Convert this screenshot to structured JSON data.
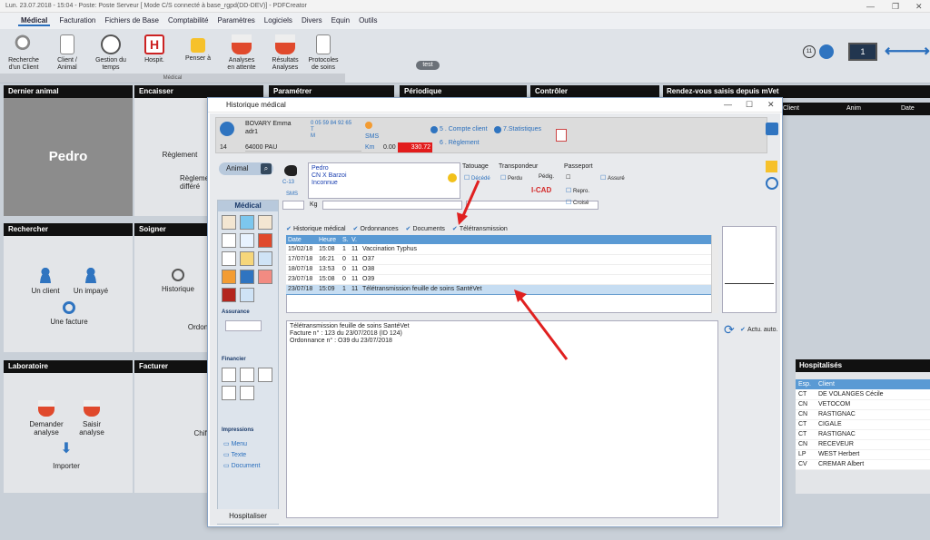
{
  "titlebar": {
    "text": "Lun. 23.07.2018 - 15:04 - Poste: Poste Serveur [ Mode C/S connecté à base_rgpd(DD-DEV)] - PDFCreator"
  },
  "menu": [
    "Médical",
    "Facturation",
    "Fichiers de Base",
    "Comptabilité",
    "Paramètres",
    "Logiciels",
    "Divers",
    "Equin",
    "Outils"
  ],
  "ribbon": {
    "buttons": [
      "Recherche\nd'un Client",
      "Client /\nAnimal",
      "Gestion du\ntemps",
      "Hospit.",
      "Penser à",
      "Analyses\nen attente",
      "Résultats\nAnalyses",
      "Protocoles\nde soins"
    ],
    "group_label": "Médical",
    "test_badge": "test",
    "count_badge": "11",
    "screen_label": "1"
  },
  "panels": {
    "dernier_animal": "Dernier animal",
    "animal_name": "Pedro",
    "encaisser": "Encaisser",
    "reglement": "Règlement",
    "reglement_diff": "Règleme\ndifféré",
    "parametrer": "Paramétrer",
    "periodique": "Périodique",
    "controler": "Contrôler",
    "rechercher": "Rechercher",
    "un_client": "Un client",
    "un_impaye": "Un impayé",
    "une_facture": "Une facture",
    "soigner": "Soigner",
    "historique": "Historique",
    "ordonnance": "Ordonna",
    "laboratoire": "Laboratoire",
    "demander_analyse": "Demander\nanalyse",
    "saisir_analyse": "Saisir\nanalyse",
    "importer": "Importer",
    "facturer": "Facturer",
    "chiffrer": "Chiffr"
  },
  "rdv": {
    "title": "Rendez-vous saisis depuis mVet",
    "cols": [
      "Client",
      "Anim",
      "Date"
    ]
  },
  "hospitalises": {
    "title": "Hospitalisés",
    "cols": [
      "Esp.",
      "Client"
    ],
    "rows": [
      [
        "CT",
        "DE VOLANGES Cécile"
      ],
      [
        "CN",
        "VETOCOM"
      ],
      [
        "CN",
        "RASTIGNAC"
      ],
      [
        "CT",
        "CIGALE"
      ],
      [
        "CT",
        "RASTIGNAC"
      ],
      [
        "CN",
        "RECEVEUR"
      ],
      [
        "LP",
        "WEST Herbert"
      ],
      [
        "CV",
        "CREMAR Albert"
      ]
    ]
  },
  "dialog": {
    "title": "Historique médical",
    "client_name": "BOVARY Emma",
    "client_sub": "adr1",
    "phone": "0 05 59 84 92 65",
    "phone_t": "T",
    "phone_m": "M",
    "addr_num": "14",
    "city": "64000 PAU",
    "sms": "SMS",
    "km": "Km",
    "balance_zero": "0.00",
    "balance": "330.72",
    "compte_client": "5 . Compte client",
    "statistiques": "7.Statistiques",
    "reglement": "6 . Règlement",
    "animal_btn": "Animal",
    "animal_code": "C-13",
    "animal_sms": "SMS",
    "animal_lines": [
      "Pedro",
      "CN X Barzoi",
      "Inconnue"
    ],
    "kg": "Kg",
    "tatouage": "Tatouage",
    "transpondeur": "Transpondeur",
    "passeport": "Passeport",
    "decede": "Décédé",
    "perdu": "Perdu",
    "pedig": "Pédig.",
    "assure": "Assuré",
    "repro": "Repro.",
    "croise": "Croisé",
    "icad": "I-CAD",
    "medical_tab": "Médical",
    "assurance": "Assurance",
    "financier": "Financier",
    "impressions": "Impressions",
    "menu_label": "Menu",
    "texte_label": "Texte",
    "document_label": "Document",
    "hospitaliser": "Hospitaliser",
    "filters": [
      "Historique médical",
      "Ordonnances",
      "Documents",
      "Télétransmission"
    ],
    "table_cols": [
      "Date",
      "Heure",
      "S.",
      "V."
    ],
    "rows": [
      [
        "15/02/18",
        "15:08",
        "1",
        "11",
        "Vaccination Typhus"
      ],
      [
        "17/07/18",
        "16:21",
        "0",
        "11",
        "O37"
      ],
      [
        "18/07/18",
        "13:53",
        "0",
        "11",
        "O38"
      ],
      [
        "23/07/18",
        "15:08",
        "0",
        "11",
        "O39"
      ],
      [
        "23/07/18",
        "15:09",
        "1",
        "11",
        "Télétransmission feuille de soins SantéVet"
      ]
    ],
    "detail_lines": [
      "Télétransmission feuille de soins SantéVet",
      "Facture n° : 123 du 23/07/2018 (ID 124)",
      "Ordonnance n° : O39 du 23/07/2018"
    ],
    "actu_auto": "Actu. auto."
  },
  "colors": {
    "accent": "#2a6fbd",
    "header_black": "#111111",
    "table_head": "#5a9ad4",
    "balance_red": "#e21c1c",
    "arrow": "#e02020"
  }
}
